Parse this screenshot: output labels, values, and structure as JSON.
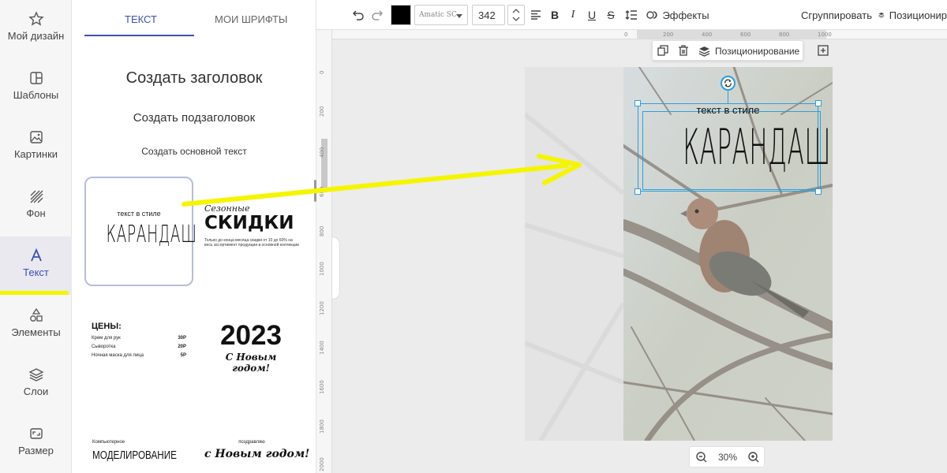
{
  "sidebar": {
    "items": [
      {
        "label": "Мой дизайн",
        "icon": "star-icon"
      },
      {
        "label": "Шаблоны",
        "icon": "template-icon"
      },
      {
        "label": "Картинки",
        "icon": "image-icon"
      },
      {
        "label": "Фон",
        "icon": "hatch-background-icon"
      },
      {
        "label": "Текст",
        "icon": "text-icon"
      },
      {
        "label": "Элементы",
        "icon": "shapes-icon"
      },
      {
        "label": "Слои",
        "icon": "layers-icon"
      },
      {
        "label": "Размер",
        "icon": "resize-icon"
      }
    ],
    "active": "Текст",
    "accent_color": "#3b4fb8",
    "highlight_color": "#f5f500"
  },
  "panel": {
    "tabs": [
      {
        "label": "ТЕКСТ",
        "active": true
      },
      {
        "label": "МОИ ШРИФТЫ",
        "active": false
      }
    ],
    "create_heading": "Создать заголовок",
    "create_subheading": "Создать подзаголовок",
    "create_body": "Создать основной текст",
    "templates": [
      {
        "small": "текст в стиле",
        "big": "КАРАНДАШ",
        "selected": true
      },
      {
        "script": "Сезонные",
        "big": "СКИДКИ",
        "small": "Только до конца месяца скидки от 10 до 60% на весь ассортимент продукции в основной коллекции"
      },
      {
        "title": "ЦЕНЫ:",
        "rows": [
          {
            "item": "Крем для рук",
            "price": "30Р"
          },
          {
            "item": "Сыворотка",
            "price": "20Р"
          },
          {
            "item": "Ночная маска для лица",
            "price": "5Р"
          }
        ]
      },
      {
        "big": "2023",
        "script": "С Новым годом!"
      },
      {
        "small": "Компьютерное",
        "big": "МОДЕЛИРОВАНИЕ"
      },
      {
        "small": "поздравляю",
        "big": "с Новым годом!"
      }
    ]
  },
  "toolbar": {
    "undo_icon": "undo-icon",
    "redo_icon": "redo-icon",
    "text_color": "#000000",
    "font_name": "Amatic SC",
    "font_size": "342",
    "effects_label": "Эффекты",
    "group_label": "Сгруппировать",
    "position_label": "Позиционир"
  },
  "rulers": {
    "top": [
      "0",
      "200",
      "400",
      "600",
      "800",
      "1000"
    ],
    "left": [
      "0",
      "200",
      "400",
      "600",
      "800",
      "1000",
      "1200",
      "1400",
      "1600",
      "1800",
      "2000"
    ]
  },
  "context_bar": {
    "position_label": "Позиционирование"
  },
  "canvas": {
    "text_small": "текст в стиле",
    "text_big": "КАРАНДАШ",
    "selection_color": "#2a9fe0"
  },
  "zoom": {
    "level": "30%"
  }
}
